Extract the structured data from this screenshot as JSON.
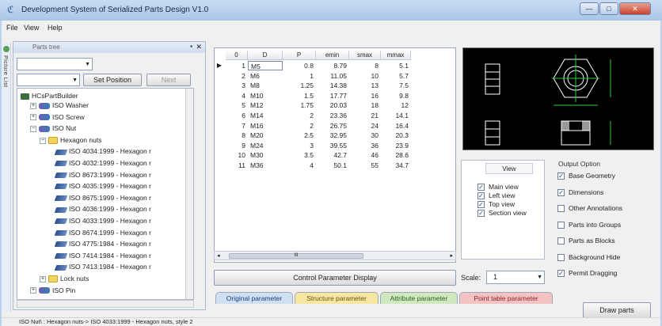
{
  "window": {
    "title": "Development System of Serialized Parts Design V1.0",
    "buttons": [
      "—",
      "□",
      "✕"
    ]
  },
  "menu": [
    "File",
    "View",
    "Help"
  ],
  "left_strip": {
    "label": "Picture List"
  },
  "parts_tree": {
    "title": "Parts tree",
    "pin": "▪",
    "close": "✕",
    "combo1_value": "",
    "combo2_value": "",
    "set_position": "Set Position",
    "next": "Next",
    "root": "HCsPartBuilder",
    "items": [
      {
        "label": "ISO Washer",
        "level": 1,
        "icon": "part-family-icon",
        "expander": "+"
      },
      {
        "label": "ISO Screw",
        "level": 1,
        "icon": "part-family-icon",
        "expander": "+"
      },
      {
        "label": "ISO Nut",
        "level": 1,
        "icon": "part-family-icon",
        "expander": "−"
      },
      {
        "label": "Hexagon nuts",
        "level": 2,
        "icon": "folder-icon",
        "expander": "−"
      },
      {
        "label": "ISO 4034:1999 - Hexagon r",
        "level": 3,
        "icon": "part-icon"
      },
      {
        "label": "ISO 4032:1999 - Hexagon r",
        "level": 3,
        "icon": "part-icon"
      },
      {
        "label": "ISO 8673:1999 - Hexagon r",
        "level": 3,
        "icon": "part-icon"
      },
      {
        "label": "ISO 4035:1999 - Hexagon r",
        "level": 3,
        "icon": "part-icon"
      },
      {
        "label": "ISO 8675:1999 - Hexagon r",
        "level": 3,
        "icon": "part-icon"
      },
      {
        "label": "ISO 4036:1999 - Hexagon r",
        "level": 3,
        "icon": "part-icon"
      },
      {
        "label": "ISO 4033:1999 - Hexagon r",
        "level": 3,
        "icon": "part-icon"
      },
      {
        "label": "ISO 8674:1999 - Hexagon r",
        "level": 3,
        "icon": "part-icon"
      },
      {
        "label": "ISO 4775:1984 - Hexagon r",
        "level": 3,
        "icon": "part-icon"
      },
      {
        "label": "ISO 7414:1984 - Hexagon r",
        "level": 3,
        "icon": "part-icon"
      },
      {
        "label": "ISO 7413:1984 - Hexagon r",
        "level": 3,
        "icon": "part-icon"
      },
      {
        "label": "Lock nuts",
        "level": 2,
        "icon": "folder-icon",
        "expander": "+"
      },
      {
        "label": "ISO Pin",
        "level": 1,
        "icon": "part-family-icon",
        "expander": "+"
      }
    ]
  },
  "grid": {
    "columns": [
      "0",
      "D",
      "P",
      "emin",
      "smax",
      "mmax"
    ],
    "rows": [
      [
        "1",
        "M5",
        "0.8",
        "8.79",
        "8",
        "5.1"
      ],
      [
        "2",
        "M6",
        "1",
        "11.05",
        "10",
        "5.7"
      ],
      [
        "3",
        "M8",
        "1.25",
        "14.38",
        "13",
        "7.5"
      ],
      [
        "4",
        "M10",
        "1.5",
        "17.77",
        "16",
        "9.8"
      ],
      [
        "5",
        "M12",
        "1.75",
        "20.03",
        "18",
        "12"
      ],
      [
        "6",
        "M14",
        "2",
        "23.36",
        "21",
        "14.1"
      ],
      [
        "7",
        "M16",
        "2",
        "26.75",
        "24",
        "16.4"
      ],
      [
        "8",
        "M20",
        "2.5",
        "32.95",
        "30",
        "20.3"
      ],
      [
        "9",
        "M24",
        "3",
        "39.55",
        "36",
        "23.9"
      ],
      [
        "10",
        "M30",
        "3.5",
        "42.7",
        "46",
        "28.6"
      ],
      [
        "11",
        "M36",
        "4",
        "50.1",
        "55",
        "34.7"
      ]
    ],
    "selected_marker": "▶",
    "scroll_thumb": "III",
    "scroll_left": "◂",
    "scroll_right": "▸"
  },
  "control_param_button": "Control Parameter Display",
  "views": {
    "header": "View",
    "items": [
      {
        "label": "Main view",
        "checked": true
      },
      {
        "label": "Left view",
        "checked": true
      },
      {
        "label": "Top view",
        "checked": true
      },
      {
        "label": "Section view",
        "checked": true
      }
    ]
  },
  "scale": {
    "label": "Scale:",
    "value": "1"
  },
  "output": {
    "title": "Output Option",
    "items": [
      {
        "label": "Base Geometry",
        "checked": true
      },
      {
        "label": "Dimensions",
        "checked": true
      },
      {
        "label": "Other Annotations",
        "checked": false
      },
      {
        "label": "Parts into Groups",
        "checked": false
      },
      {
        "label": "Parts as Blocks",
        "checked": false
      },
      {
        "label": "Background Hide",
        "checked": false
      },
      {
        "label": "Permit Dragging",
        "checked": true
      }
    ]
  },
  "tabs": [
    {
      "label": "Original parameter",
      "color": "#cfe0f3",
      "text": "#1d3d78"
    },
    {
      "label": "Structure parameter",
      "color": "#f6e7a2",
      "text": "#6a5410"
    },
    {
      "label": "Attribute parameter",
      "color": "#cfe8c0",
      "text": "#2f5d22"
    },
    {
      "label": "Point table parameter",
      "color": "#f3c3c3",
      "text": "#8a2424"
    }
  ],
  "draw_parts": "Draw parts",
  "status": "ISO Nut\\ : Hexagon nuts-> ISO 4033:1999 - Hexagon nuts, style 2"
}
